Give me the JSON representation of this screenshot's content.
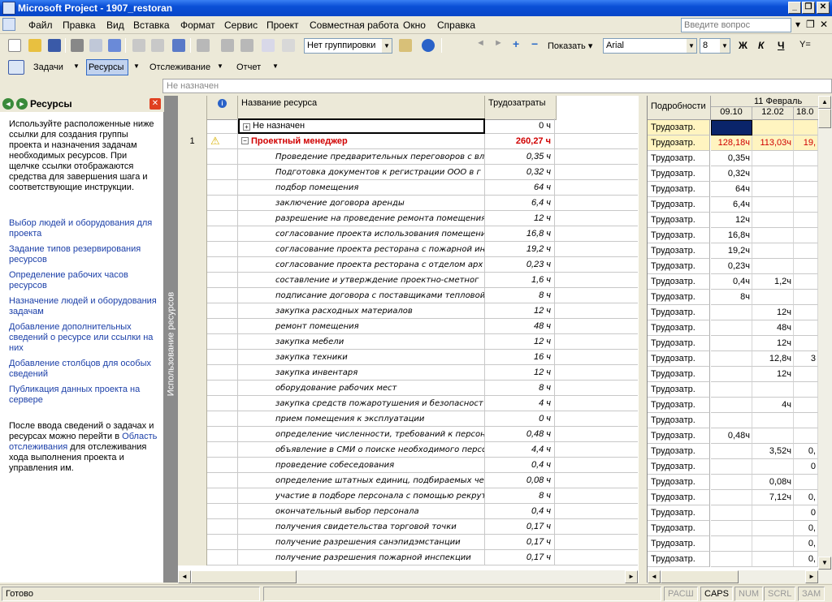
{
  "window": {
    "title": "Microsoft Project - 1907_restoran"
  },
  "menu": {
    "items": [
      "Файл",
      "Правка",
      "Вид",
      "Вставка",
      "Формат",
      "Сервис",
      "Проект",
      "Совместная работа",
      "Окно",
      "Справка"
    ],
    "ask_placeholder": "Введите вопрос"
  },
  "toolbar1": {
    "grouping": "Нет группировки",
    "show_label": "Показать",
    "font": "Arial",
    "font_size": "8",
    "bold": "Ж",
    "italic": "К",
    "underline": "Ч"
  },
  "toolbar2": {
    "tasks": "Задачи",
    "resources": "Ресурсы",
    "tracking": "Отслеживание",
    "report": "Отчет"
  },
  "entry_bar": {
    "value": "Не назначен"
  },
  "pane": {
    "title": "Ресурсы",
    "intro": "Используйте расположенные ниже ссылки для создания группы проекта и назначения задачам необходимых ресурсов. При щелчке ссылки отображаются средства для завершения шага и соответствующие инструкции.",
    "links": [
      "Выбор людей и оборудования для проекта",
      "Задание типов резервирования ресурсов",
      "Определение рабочих часов ресурсов",
      "Назначение людей и оборудования задачам",
      "Добавление дополнительных сведений о ресурсе или ссылки на них",
      "Добавление столбцов для особых сведений",
      "Публикация данных проекта на сервере"
    ],
    "outro_1": "После ввода сведений о задачах и ресурсах можно перейти в",
    "outro_link": "Область отслеживания",
    "outro_2": "для отслеживания хода выполнения проекта и управления им."
  },
  "view_bar": {
    "label": "Использование ресурсов"
  },
  "table": {
    "headers": {
      "name": "Название ресурса",
      "work": "Трудозатраты"
    },
    "rows": [
      {
        "id": "",
        "name": "Не назначен",
        "work": "0 ч",
        "kind": "unassigned"
      },
      {
        "id": "1",
        "name": "Проектный менеджер",
        "work": "260,27 ч",
        "kind": "resource"
      },
      {
        "id": "",
        "name": "Проведение предварительных переговоров с вл",
        "work": "0,35 ч",
        "kind": "a"
      },
      {
        "id": "",
        "name": "Подготовка документов к регистрации ООО в г",
        "work": "0,32 ч",
        "kind": "a"
      },
      {
        "id": "",
        "name": "подбор помещения",
        "work": "64 ч",
        "kind": "a"
      },
      {
        "id": "",
        "name": "заключение договора аренды",
        "work": "6,4 ч",
        "kind": "a"
      },
      {
        "id": "",
        "name": "разрешение на проведение ремонта помещения",
        "work": "12 ч",
        "kind": "a"
      },
      {
        "id": "",
        "name": "согласование проекта использования помещени",
        "work": "16,8 ч",
        "kind": "a"
      },
      {
        "id": "",
        "name": "согласование проекта ресторана с пожарной ин",
        "work": "19,2 ч",
        "kind": "a"
      },
      {
        "id": "",
        "name": "согласование проекта ресторана с отделом арх",
        "work": "0,23 ч",
        "kind": "a"
      },
      {
        "id": "",
        "name": "составление  и утверждение проектно-сметног",
        "work": "1,6 ч",
        "kind": "a"
      },
      {
        "id": "",
        "name": "подписание договора с поставщиками тепловой",
        "work": "8 ч",
        "kind": "a"
      },
      {
        "id": "",
        "name": "закупка расходных материалов",
        "work": "12 ч",
        "kind": "a"
      },
      {
        "id": "",
        "name": "ремонт помещения",
        "work": "48 ч",
        "kind": "a"
      },
      {
        "id": "",
        "name": "закупка мебели",
        "work": "12 ч",
        "kind": "a"
      },
      {
        "id": "",
        "name": "закупка техники",
        "work": "16 ч",
        "kind": "a"
      },
      {
        "id": "",
        "name": "закупка инвентаря",
        "work": "12 ч",
        "kind": "a"
      },
      {
        "id": "",
        "name": "оборудование рабочих мест",
        "work": "8 ч",
        "kind": "a"
      },
      {
        "id": "",
        "name": "закупка средств пожаротушения и безопасност",
        "work": "4 ч",
        "kind": "a"
      },
      {
        "id": "",
        "name": "прием помещения к эксплуатации",
        "work": "0 ч",
        "kind": "a"
      },
      {
        "id": "",
        "name": "определение численности, требований к персон",
        "work": "0,48 ч",
        "kind": "a"
      },
      {
        "id": "",
        "name": "объявление в СМИ о поиске необходимого персо",
        "work": "4,4 ч",
        "kind": "a"
      },
      {
        "id": "",
        "name": "проведение собеседования",
        "work": "0,4 ч",
        "kind": "a"
      },
      {
        "id": "",
        "name": "определение штатных единиц, подбираемых чер",
        "work": "0,08 ч",
        "kind": "a"
      },
      {
        "id": "",
        "name": "участие в подборе персонала с помощью рекрут",
        "work": "8 ч",
        "kind": "a"
      },
      {
        "id": "",
        "name": "окончательный выбор персонала",
        "work": "0,4 ч",
        "kind": "a"
      },
      {
        "id": "",
        "name": "получения свидетельства торговой точки",
        "work": "0,17 ч",
        "kind": "a"
      },
      {
        "id": "",
        "name": "получение разрешения санэпидэмстанции",
        "work": "0,17 ч",
        "kind": "a"
      },
      {
        "id": "",
        "name": "получение разрешения пожарной инспекции",
        "work": "0,17 ч",
        "kind": "a"
      }
    ]
  },
  "timephased": {
    "details_header": "Подробности",
    "week_label": "11 Февраль",
    "days": [
      "09.10",
      "12.02",
      "18.0"
    ],
    "detail_label": "Трудозатр.",
    "cells": [
      [
        "",
        "",
        ""
      ],
      [
        "128,18ч",
        "113,03ч",
        "19,"
      ],
      [
        "0,35ч",
        "",
        ""
      ],
      [
        "0,32ч",
        "",
        ""
      ],
      [
        "64ч",
        "",
        ""
      ],
      [
        "6,4ч",
        "",
        ""
      ],
      [
        "12ч",
        "",
        ""
      ],
      [
        "16,8ч",
        "",
        ""
      ],
      [
        "19,2ч",
        "",
        ""
      ],
      [
        "0,23ч",
        "",
        ""
      ],
      [
        "0,4ч",
        "1,2ч",
        ""
      ],
      [
        "8ч",
        "",
        ""
      ],
      [
        "",
        "12ч",
        ""
      ],
      [
        "",
        "48ч",
        ""
      ],
      [
        "",
        "12ч",
        ""
      ],
      [
        "",
        "12,8ч",
        "3"
      ],
      [
        "",
        "12ч",
        ""
      ],
      [
        "",
        "",
        ""
      ],
      [
        "",
        "4ч",
        ""
      ],
      [
        "",
        "",
        ""
      ],
      [
        "0,48ч",
        "",
        ""
      ],
      [
        "",
        "3,52ч",
        "0,"
      ],
      [
        "",
        "",
        "0"
      ],
      [
        "",
        "0,08ч",
        ""
      ],
      [
        "",
        "7,12ч",
        "0,"
      ],
      [
        "",
        "",
        "0"
      ],
      [
        "",
        "",
        "0,"
      ],
      [
        "",
        "",
        "0,"
      ],
      [
        "",
        "",
        "0,"
      ]
    ]
  },
  "status": {
    "ready": "Готово",
    "ind": [
      "РАСШ",
      "CAPS",
      "NUM",
      "SCRL",
      "ЗАМ"
    ]
  },
  "colors": {
    "resource_red": "#d00000",
    "selected_cell": "#0a246a",
    "highlight_row": "#fff4c0"
  }
}
